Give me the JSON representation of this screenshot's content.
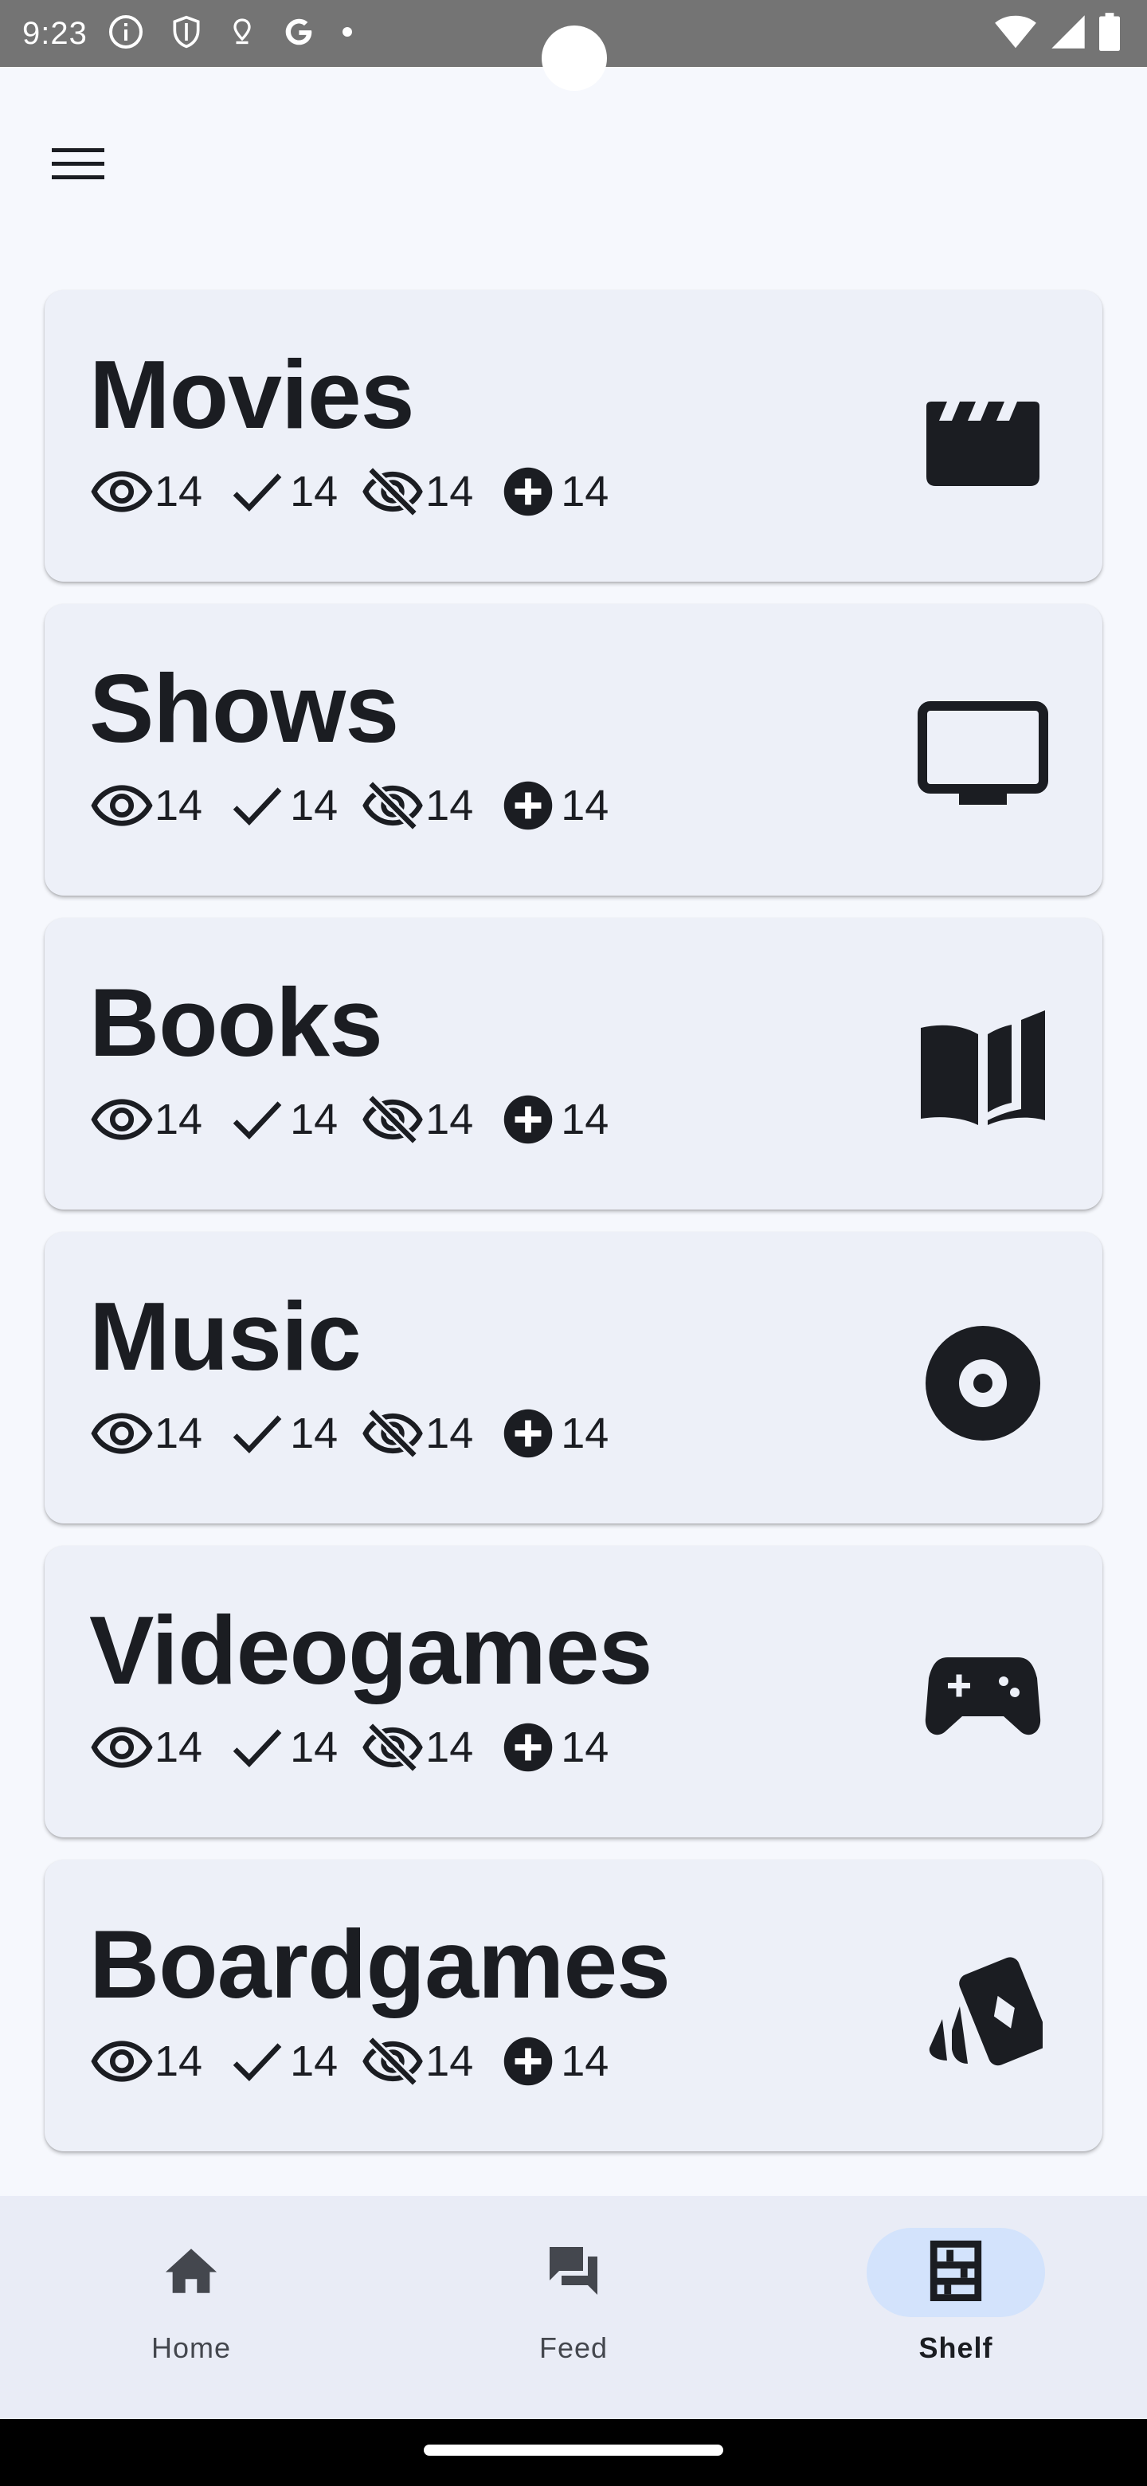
{
  "status_bar": {
    "time": "9:23",
    "left_icons": [
      "info-icon",
      "shield-icon",
      "location-pin-icon",
      "google-g-icon",
      "dot-icon"
    ],
    "right_icons": [
      "wifi-icon",
      "signal-icon",
      "battery-icon"
    ],
    "background": "#747474"
  },
  "top_bar": {
    "menu_icon": "hamburger-menu-icon"
  },
  "shelf": {
    "stat_icons": [
      "eye-icon",
      "check-icon",
      "eye-off-icon",
      "add-circle-icon"
    ],
    "categories": [
      {
        "title": "Movies",
        "icon": "clapperboard-icon",
        "watching": "14",
        "done": "14",
        "dropped": "14",
        "planned": "14"
      },
      {
        "title": "Shows",
        "icon": "tv-icon",
        "watching": "14",
        "done": "14",
        "dropped": "14",
        "planned": "14"
      },
      {
        "title": "Books",
        "icon": "book-icon",
        "watching": "14",
        "done": "14",
        "dropped": "14",
        "planned": "14"
      },
      {
        "title": "Music",
        "icon": "disc-icon",
        "watching": "14",
        "done": "14",
        "dropped": "14",
        "planned": "14"
      },
      {
        "title": "Videogames",
        "icon": "gamepad-icon",
        "watching": "14",
        "done": "14",
        "dropped": "14",
        "planned": "14"
      },
      {
        "title": "Boardgames",
        "icon": "playing-cards-icon",
        "watching": "14",
        "done": "14",
        "dropped": "14",
        "planned": "14"
      }
    ]
  },
  "bottom_nav": {
    "items": [
      {
        "label": "Home",
        "icon": "home-icon",
        "active": false
      },
      {
        "label": "Feed",
        "icon": "forum-icon",
        "active": false
      },
      {
        "label": "Shelf",
        "icon": "shelves-icon",
        "active": true
      }
    ],
    "active_pill_color": "#d3e3fc"
  },
  "colors": {
    "background": "#f6f8fd",
    "card": "#edf0f8",
    "text": "#1b1d22",
    "nav_background": "#e9ecf6"
  }
}
